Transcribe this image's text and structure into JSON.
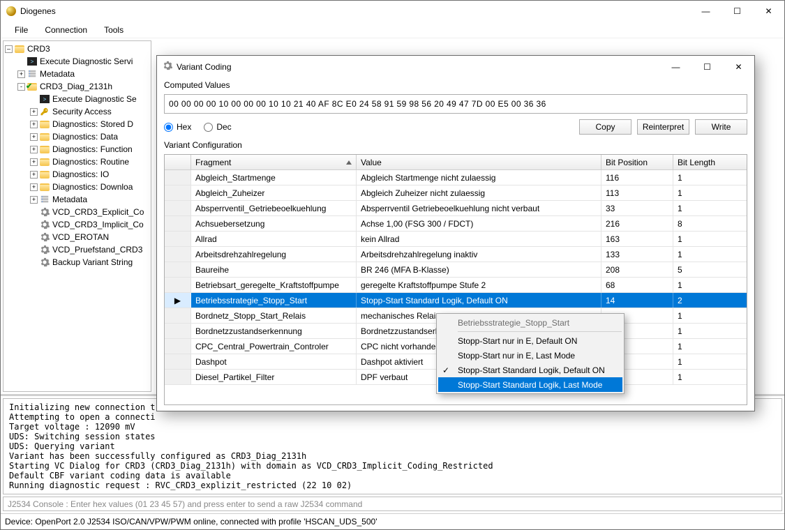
{
  "app": {
    "title": "Diogenes"
  },
  "menu": {
    "file": "File",
    "connection": "Connection",
    "tools": "Tools"
  },
  "win_buttons": {
    "min": "—",
    "max": "☐",
    "close": "✕"
  },
  "tree": {
    "root": "CRD3",
    "items": [
      {
        "kind": "term",
        "label": "Execute Diagnostic Servi",
        "indent": 1,
        "expander": ""
      },
      {
        "kind": "db",
        "label": "Metadata",
        "indent": 1,
        "expander": "+"
      },
      {
        "kind": "okfold",
        "label": "CRD3_Diag_2131h",
        "indent": 1,
        "expander": "-"
      },
      {
        "kind": "term",
        "label": "Execute Diagnostic Se",
        "indent": 2,
        "expander": ""
      },
      {
        "kind": "key",
        "label": "Security Access",
        "indent": 2,
        "expander": "+"
      },
      {
        "kind": "folder",
        "label": "Diagnostics: Stored D",
        "indent": 2,
        "expander": "+"
      },
      {
        "kind": "folder",
        "label": "Diagnostics: Data",
        "indent": 2,
        "expander": "+"
      },
      {
        "kind": "folder",
        "label": "Diagnostics: Function",
        "indent": 2,
        "expander": "+"
      },
      {
        "kind": "folder",
        "label": "Diagnostics: Routine",
        "indent": 2,
        "expander": "+"
      },
      {
        "kind": "folder",
        "label": "Diagnostics: IO",
        "indent": 2,
        "expander": "+"
      },
      {
        "kind": "folder",
        "label": "Diagnostics: Downloa",
        "indent": 2,
        "expander": "+"
      },
      {
        "kind": "db",
        "label": "Metadata",
        "indent": 2,
        "expander": "+"
      },
      {
        "kind": "gear",
        "label": "VCD_CRD3_Explicit_Co",
        "indent": 2,
        "expander": ""
      },
      {
        "kind": "gear",
        "label": "VCD_CRD3_Implicit_Co",
        "indent": 2,
        "expander": ""
      },
      {
        "kind": "gear",
        "label": "VCD_EROTAN",
        "indent": 2,
        "expander": ""
      },
      {
        "kind": "gear",
        "label": "VCD_Pruefstand_CRD3",
        "indent": 2,
        "expander": ""
      },
      {
        "kind": "gear",
        "label": "Backup Variant String",
        "indent": 2,
        "expander": ""
      }
    ]
  },
  "dialog": {
    "title": "Variant Coding",
    "computed_label": "Computed Values",
    "hex": "00 00 00 00 10 00 00 00 10 10 21 40 AF 8C E0 24 58 91 59 98 56 20 49 47 7D 00 E5 00 36 36",
    "radio_hex": "Hex",
    "radio_dec": "Dec",
    "buttons": {
      "copy": "Copy",
      "reinterpret": "Reinterpret",
      "write": "Write"
    },
    "vc_label": "Variant Configuration",
    "columns": {
      "fragment": "Fragment",
      "value": "Value",
      "bitpos": "Bit Position",
      "bitlen": "Bit Length"
    },
    "rows": [
      {
        "fragment": "Abgleich_Startmenge",
        "value": "Abgleich Startmenge nicht zulaessig",
        "bitpos": "116",
        "bitlen": "1"
      },
      {
        "fragment": "Abgleich_Zuheizer",
        "value": "Abgleich Zuheizer nicht zulaessig",
        "bitpos": "113",
        "bitlen": "1"
      },
      {
        "fragment": "Absperrventil_Getriebeoelkuehlung",
        "value": "Absperrventil Getriebeoelkuehlung nicht verbaut",
        "bitpos": "33",
        "bitlen": "1"
      },
      {
        "fragment": "Achsuebersetzung",
        "value": "Achse 1,00 (FSG 300 / FDCT)",
        "bitpos": "216",
        "bitlen": "8"
      },
      {
        "fragment": "Allrad",
        "value": "kein Allrad",
        "bitpos": "163",
        "bitlen": "1"
      },
      {
        "fragment": "Arbeitsdrehzahlregelung",
        "value": "Arbeitsdrehzahlregelung inaktiv",
        "bitpos": "133",
        "bitlen": "1"
      },
      {
        "fragment": "Baureihe",
        "value": "BR 246 (MFA B-Klasse)",
        "bitpos": "208",
        "bitlen": "5"
      },
      {
        "fragment": "Betriebsart_geregelte_Kraftstoffpumpe",
        "value": "geregelte Kraftstoffpumpe Stufe 2",
        "bitpos": "68",
        "bitlen": "1"
      },
      {
        "fragment": "Betriebsstrategie_Stopp_Start",
        "value": "Stopp-Start Standard Logik, Default ON",
        "bitpos": "14",
        "bitlen": "2",
        "selected": true
      },
      {
        "fragment": "Bordnetz_Stopp_Start_Relais",
        "value": "mechanisches Relais",
        "bitpos": "",
        "bitlen": "1"
      },
      {
        "fragment": "Bordnetzzustandserkennung",
        "value": "Bordnetzzustandserken",
        "bitpos": "",
        "bitlen": "1"
      },
      {
        "fragment": "CPC_Central_Powertrain_Controler",
        "value": "CPC nicht vorhanden",
        "bitpos": "",
        "bitlen": "1"
      },
      {
        "fragment": "Dashpot",
        "value": "Dashpot aktiviert",
        "bitpos": "",
        "bitlen": "1"
      },
      {
        "fragment": "Diesel_Partikel_Filter",
        "value": "DPF verbaut",
        "bitpos": "",
        "bitlen": "1"
      }
    ]
  },
  "ctx": {
    "title": "Betriebsstrategie_Stopp_Start",
    "items": [
      {
        "label": "Stopp-Start nur in E, Default ON"
      },
      {
        "label": "Stopp-Start nur in E, Last Mode"
      },
      {
        "label": "Stopp-Start Standard Logik, Default ON",
        "checked": true
      },
      {
        "label": "Stopp-Start Standard Logik, Last Mode",
        "hover": true
      }
    ]
  },
  "log": {
    "lines": [
      "Initializing new connection t",
      "Attempting to open a connecti",
      "Target voltage : 12090 mV",
      "UDS: Switching session states",
      "UDS: Querying variant",
      "Variant has been successfully configured as CRD3_Diag_2131h",
      "Starting VC Dialog for CRD3 (CRD3_Diag_2131h) with domain as VCD_CRD3_Implicit_Coding_Restricted",
      "Default CBF variant coding data is available",
      "Running diagnostic request : RVC_CRD3_explizit_restricted (22 10 02)"
    ]
  },
  "console_placeholder": "J2534 Console : Enter hex values (01 23 45 57) and press enter to send a raw J2534 command",
  "status": "Device: OpenPort 2.0 J2534 ISO/CAN/VPW/PWM online, connected with profile 'HSCAN_UDS_500'"
}
